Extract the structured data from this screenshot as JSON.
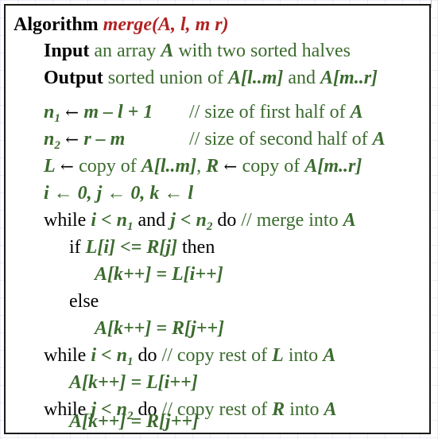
{
  "algo": {
    "keyword": "Algorithm",
    "name": "merge",
    "params": "(A, l, m r)",
    "input_keyword": "Input",
    "input_text": " an array ",
    "input_var": "A",
    "input_rest": " with two sorted halves",
    "output_keyword": "Output",
    "output_text": " sorted union of ",
    "output_a1": "A",
    "output_r1": "[l..m]",
    "output_and": " and ",
    "output_a2": "A",
    "output_r2": "[m..r]"
  },
  "lines": {
    "l1_var": "n",
    "l1_sub": "1",
    "l1_arrow": " ← ",
    "l1_expr": "m – l + 1",
    "l1_comment": "// size of first half of ",
    "l1_cvar": "A",
    "l2_var": "n",
    "l2_sub": "2",
    "l2_arrow": " ← ",
    "l2_expr": "r – m",
    "l2_comment": "// size of second half of ",
    "l2_cvar": "A",
    "l3_L": "L",
    "l3_arrow": " ← ",
    "l3_copy": "copy of ",
    "l3_A": "A",
    "l3_range": "[l..m]",
    "l3_sep": ",  ",
    "l3_R": "R",
    "l3_arrow2": " ← ",
    "l3_copy2": "copy of ",
    "l3_A2": "A",
    "l3_range2": "[m..r]",
    "l4_text": "i ← 0,  j ← 0,  k ← l",
    "l5_while": "while ",
    "l5_cond1": "i < n",
    "l5_sub1": "1",
    "l5_and": " and ",
    "l5_cond2": "j < n",
    "l5_sub2": "2",
    "l5_do": " do  ",
    "l5_comment": "// merge into ",
    "l5_cvar": "A",
    "l6_if": "if ",
    "l6_cond": "L[i] <= R[j]",
    "l6_then": " then",
    "l7_stmt": "A[k++] = L[i++]",
    "l8_else": "else",
    "l9_stmt": "A[k++] = R[j++]",
    "l10_while": "while ",
    "l10_cond": "i < n",
    "l10_sub": "1",
    "l10_do": " do ",
    "l10_comment": "// copy rest of ",
    "l10_cvar": "L",
    "l10_into": " into ",
    "l10_cvar2": "A",
    "l11_stmt": "A[k++] = L[i++]",
    "l12_while": "while ",
    "l12_cond": "j < n",
    "l12_sub": "2",
    "l12_do": " do ",
    "l12_comment": "// copy rest of ",
    "l12_cvar": "R",
    "l12_into": " into ",
    "l12_cvar2": "A",
    "l13_stmt": "A[k++] = R[j++]"
  },
  "colors": {
    "variable": "#3b6b2e",
    "function_name": "#b22222",
    "text": "#000000"
  }
}
